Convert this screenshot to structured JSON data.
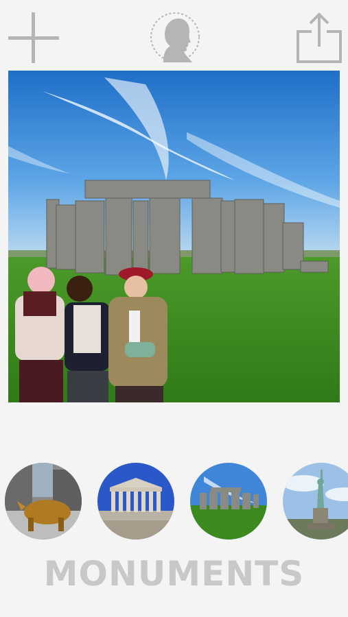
{
  "toolbar": {
    "add_icon": "plus-icon",
    "avatar_icon": "silhouette-profile-icon",
    "share_icon": "share-icon"
  },
  "canvas": {
    "scene": "stonehenge-background",
    "overlay": "three-people-cutout"
  },
  "thumbnails": [
    {
      "id": "wall-street-bull",
      "icon": "charging-bull"
    },
    {
      "id": "parthenon",
      "icon": "parthenon"
    },
    {
      "id": "stonehenge",
      "icon": "stonehenge"
    },
    {
      "id": "statue-of-liberty",
      "icon": "statue-of-liberty"
    }
  ],
  "category_label": "MONUMENTS",
  "colors": {
    "background": "#f4f4f4",
    "icon_gray": "#b5b5b5",
    "label_gray": "#c8c8c8",
    "sky_blue": "#2d7fd6",
    "grass_green": "#3d8a1f"
  }
}
